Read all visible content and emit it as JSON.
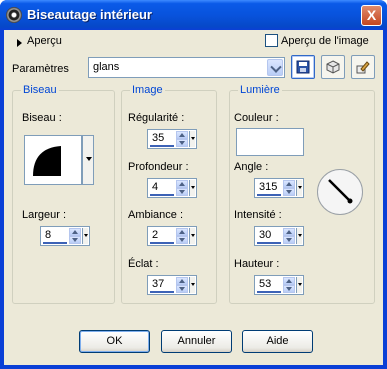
{
  "window": {
    "title": "Biseautage intérieur",
    "close_label": "X"
  },
  "preview": {
    "label": "Aperçu",
    "image_preview_label": "Aperçu de l'image",
    "image_preview_checked": false
  },
  "params": {
    "label": "Paramètres",
    "preset_value": "glans"
  },
  "bevel": {
    "title": "Biseau",
    "shape_label": "Biseau :",
    "width_label": "Largeur :",
    "width_value": "8"
  },
  "image": {
    "title": "Image",
    "smoothness_label": "Régularité :",
    "smoothness_value": "35",
    "depth_label": "Profondeur :",
    "depth_value": "4",
    "ambience_label": "Ambiance :",
    "ambience_value": "2",
    "shine_label": "Éclat :",
    "shine_value": "37"
  },
  "light": {
    "title": "Lumière",
    "color_label": "Couleur :",
    "color": "#ffffff",
    "angle_label": "Angle :",
    "angle_value": "315",
    "intensity_label": "Intensité :",
    "intensity_value": "30",
    "elevation_label": "Hauteur :",
    "elevation_value": "53"
  },
  "buttons": {
    "ok": "OK",
    "cancel": "Annuler",
    "help": "Aide"
  },
  "icons": {
    "window": "app-icon",
    "preset_save": "floppy-disk-icon",
    "preset_manage": "cube-icon",
    "preset_reset": "pencil-icon",
    "expand": "triangle-right-icon"
  }
}
